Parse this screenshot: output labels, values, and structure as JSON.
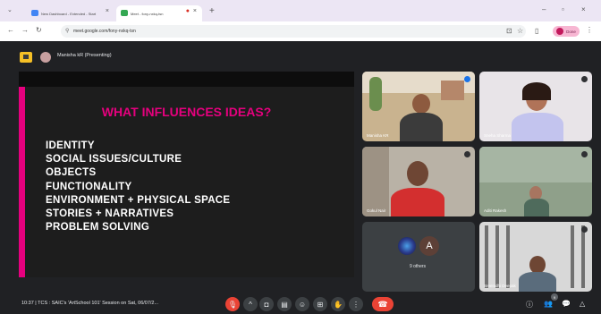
{
  "browser": {
    "tabs": [
      {
        "label": "New Dashboard - Extended - Start",
        "favicon_color": "#4285f4"
      },
      {
        "label": "Meet - fony-nxkq-tsn",
        "favicon_color": "#34a853"
      }
    ],
    "url": "meet.google.com/fony-nxkq-tsn",
    "profile_label": "Done"
  },
  "meeting": {
    "presenter_label": "Manisha kR (Presenting)",
    "time": "10:37",
    "title": "TCS : SAIC's 'ArtSchool 101' Session on Sat, 06/07/2...",
    "controls": [
      "mic-icon",
      "chevron-icon",
      "camera-icon",
      "captions-icon",
      "emoji-icon",
      "present-icon",
      "raise-hand-icon",
      "more-icon",
      "end-call-icon"
    ],
    "right_icons": [
      "info-icon",
      "people-icon",
      "chat-icon",
      "activities-icon"
    ],
    "people_badge": "9"
  },
  "slide": {
    "title": "WHAT INFLUENCES IDEAS?",
    "items": [
      "IDENTITY",
      "SOCIAL ISSUES/CULTURE",
      "OBJECTS",
      "FUNCTIONALITY",
      "ENVIRONMENT + PHYSICAL SPACE",
      "STORIES + NARRATIVES",
      "PROBLEM SOLVING"
    ],
    "accent": "#e6007e"
  },
  "participants": [
    {
      "name": "Manisha KR"
    },
    {
      "name": "Sneha Sharma"
    },
    {
      "name": "Gokul Nair"
    },
    {
      "name": "Aditi Rakesh"
    },
    {
      "others_label": "9 others",
      "avatar_letter": "A"
    },
    {
      "name": "Sreenidhi Deepak"
    }
  ]
}
